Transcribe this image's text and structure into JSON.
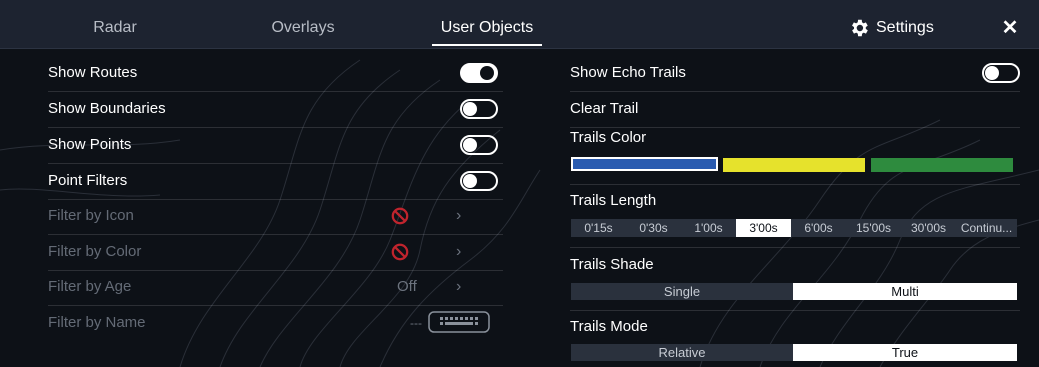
{
  "tabs": [
    {
      "label": "Radar",
      "active": false
    },
    {
      "label": "Overlays",
      "active": false
    },
    {
      "label": "User Objects",
      "active": true
    }
  ],
  "header": {
    "settings_label": "Settings",
    "close_glyph": "✕",
    "settings_icon": "gear-icon"
  },
  "left": {
    "rows": [
      {
        "label": "Show Routes",
        "control": "toggle",
        "on": true,
        "enabled": true
      },
      {
        "label": "Show Boundaries",
        "control": "toggle",
        "on": false,
        "enabled": true
      },
      {
        "label": "Show Points",
        "control": "toggle",
        "on": false,
        "enabled": true
      },
      {
        "label": "Point Filters",
        "control": "toggle",
        "on": false,
        "enabled": true
      },
      {
        "label": "Filter by Icon",
        "control": "no-symbol",
        "enabled": false
      },
      {
        "label": "Filter by Color",
        "control": "no-symbol",
        "enabled": false
      },
      {
        "label": "Filter by Age",
        "control": "value",
        "value": "Off",
        "enabled": false
      },
      {
        "label": "Filter by Name",
        "control": "keyboard",
        "value": "---",
        "enabled": false
      }
    ]
  },
  "right": {
    "echo_trails": {
      "label": "Show Echo Trails",
      "on": false
    },
    "clear_trail": {
      "label": "Clear Trail"
    },
    "trails_color": {
      "label": "Trails Color",
      "swatches": [
        {
          "name": "blue",
          "color": "#2a5bb0",
          "selected": true
        },
        {
          "name": "yellow",
          "color": "#e6e22c",
          "selected": false
        },
        {
          "name": "green",
          "color": "#2e8b3e",
          "selected": false
        }
      ]
    },
    "trails_length": {
      "label": "Trails Length",
      "options": [
        "0'15s",
        "0'30s",
        "1'00s",
        "3'00s",
        "6'00s",
        "15'00s",
        "30'00s",
        "Continu..."
      ],
      "selected": "3'00s"
    },
    "trails_shade": {
      "label": "Trails Shade",
      "options": [
        "Single",
        "Multi"
      ],
      "selected": "Multi"
    },
    "trails_mode": {
      "label": "Trails Mode",
      "options": [
        "Relative",
        "True"
      ],
      "selected": "True"
    }
  },
  "colors": {
    "accent_no": "#c0242d",
    "panel_bg": "#0d1117",
    "header_bg": "#1d2330"
  }
}
